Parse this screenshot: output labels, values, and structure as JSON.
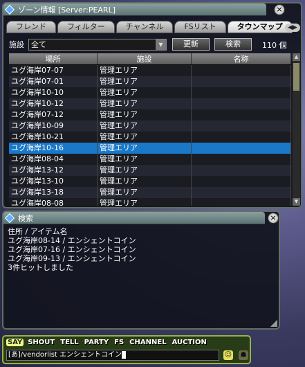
{
  "zone": {
    "title": "ゾーン情報 [Server:PEARL]",
    "tabs": [
      "フレンド",
      "フィルター",
      "チャンネル",
      "FSリスト",
      "タウンマップ"
    ],
    "active_tab": 4,
    "filter_label": "施設",
    "filter_value": "全て",
    "update_label": "更新",
    "search_label": "検索",
    "count_text": "110 個",
    "columns": [
      "場所",
      "施設",
      "名称"
    ],
    "rows": [
      [
        "ユグ海岸07-07",
        "管理エリア",
        ""
      ],
      [
        "ユグ海岸07-01",
        "管理エリア",
        ""
      ],
      [
        "ユグ海岸10-10",
        "管理エリア",
        ""
      ],
      [
        "ユグ海岸10-12",
        "管理エリア",
        ""
      ],
      [
        "ユグ海岸07-12",
        "管理エリア",
        ""
      ],
      [
        "ユグ海岸10-09",
        "管理エリア",
        ""
      ],
      [
        "ユグ海岸10-21",
        "管理エリア",
        ""
      ],
      [
        "ユグ海岸10-16",
        "管理エリア",
        ""
      ],
      [
        "ユグ海岸08-04",
        "管理エリア",
        ""
      ],
      [
        "ユグ海岸13-12",
        "管理エリア",
        ""
      ],
      [
        "ユグ海岸13-10",
        "管理エリア",
        ""
      ],
      [
        "ユグ海岸13-18",
        "管理エリア",
        ""
      ],
      [
        "ユグ海岸08-08",
        "管理エリア",
        ""
      ]
    ],
    "selected_row": 7
  },
  "search": {
    "title": "検索",
    "lines": [
      "住所 / アイテム名",
      "ユグ海岸08-14 / エンシェントコイン",
      "ユグ海岸07-16 / エンシェントコイン",
      "ユグ海岸09-13 / エンシェントコイン",
      "3件ヒットしました"
    ]
  },
  "chat": {
    "tabs": [
      "SAY",
      "SHOUT",
      "TELL",
      "PARTY",
      "FS",
      "CHANNEL",
      "AUCTION"
    ],
    "active_tab": 0,
    "input_value": "[あ]/vendorlist エンシェントコイン"
  },
  "icons": {
    "close": "close-icon",
    "smiley": "smiley-icon",
    "avatar": "avatar-icon"
  }
}
